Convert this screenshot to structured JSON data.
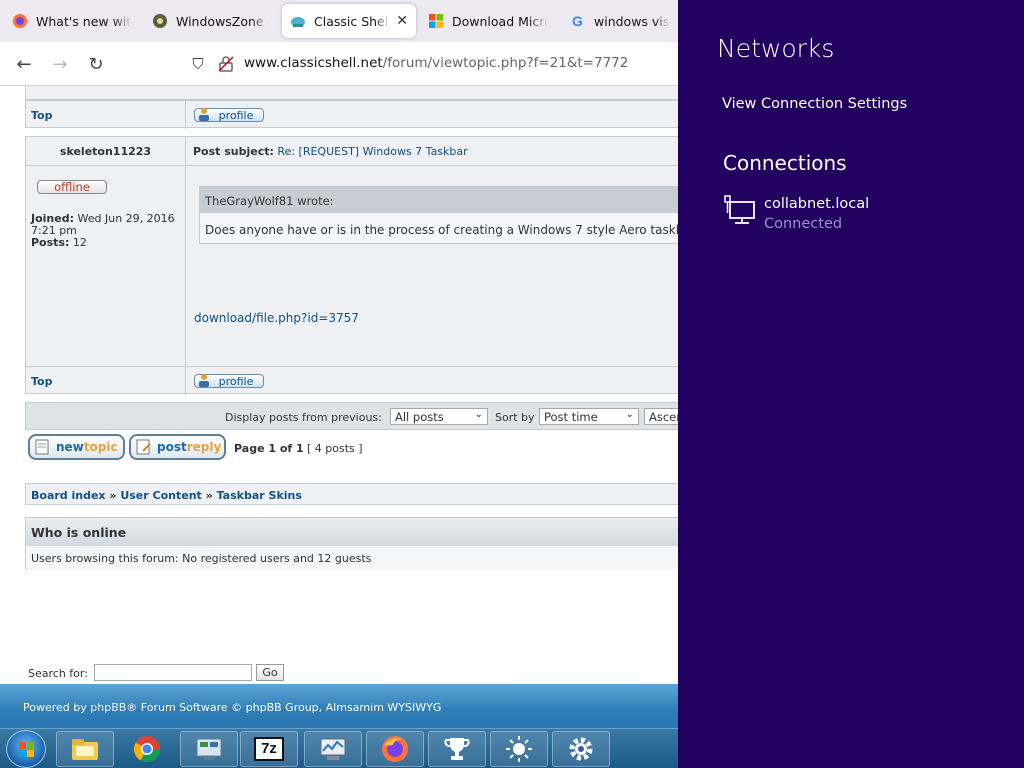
{
  "browser": {
    "tabs": [
      {
        "label": "What's new with Fi",
        "icon": "firefox-icon"
      },
      {
        "label": "WindowsZone - St",
        "icon": "windowszone-icon"
      },
      {
        "label": "Classic Shell • Vi",
        "icon": "classicshell-icon",
        "active": true
      },
      {
        "label": "Download Micros",
        "icon": "microsoft-icon"
      },
      {
        "label": "windows vista wa",
        "icon": "google-icon"
      }
    ],
    "url_host": "www.classicshell.net",
    "url_path": "/forum/viewtopic.php?f=21&t=7772"
  },
  "forum": {
    "top_label": "Top",
    "profile_label": "profile",
    "author": "skeleton11223",
    "post_subject_label": "Post subject:",
    "post_subject": "Re: [REQUEST] Windows 7 Taskbar",
    "status": "offline",
    "joined_label": "Joined:",
    "joined_value": "Wed Jun 29, 2016",
    "joined_time": "7:21 pm",
    "posts_label": "Posts:",
    "posts_value": "12",
    "quote_author": "TheGrayWolf81 wrote:",
    "quote_text": "Does anyone have or is in the process of creating a Windows 7 style Aero taskbar",
    "attachment_link": "download/file.php?id=3757",
    "display_label": "Display posts from previous:",
    "display_value": "All posts",
    "sort_label": "Sort by",
    "sort_value": "Post time",
    "order_value": "Ascending",
    "newtopic_a": "new",
    "newtopic_b": "topic",
    "postreply_a": "post",
    "postreply_b": "reply",
    "page_info": "Page 1 of 1",
    "posts_count": "[ 4 posts ]",
    "breadcrumb": [
      "Board index",
      "User Content",
      "Taskbar Skins"
    ],
    "breadcrumb_sep": "»",
    "who_online_title": "Who is online",
    "who_online_text": "Users browsing this forum: No registered users and 12 guests",
    "search_label": "Search for:",
    "search_value": "",
    "go_label": "Go",
    "footer_a": "Powered by ",
    "footer_phpbb": "phpBB",
    "footer_b": "® Forum Software © phpBB Group, Almsamim WYSIWYG"
  },
  "taskbar": {
    "items": [
      "file-explorer-icon",
      "chrome-icon",
      "control-panel-icon",
      "7zip-icon",
      "system-monitor-icon",
      "firefox-icon",
      "trophy-icon",
      "brightness-icon",
      "settings-icon"
    ],
    "sevenzip_label": "7z"
  },
  "networks": {
    "title": "Networks",
    "view_settings": "View Connection Settings",
    "connections_heading": "Connections",
    "connection_name": "collabnet.local",
    "connection_status": "Connected",
    "bg_color": "#21005f"
  }
}
